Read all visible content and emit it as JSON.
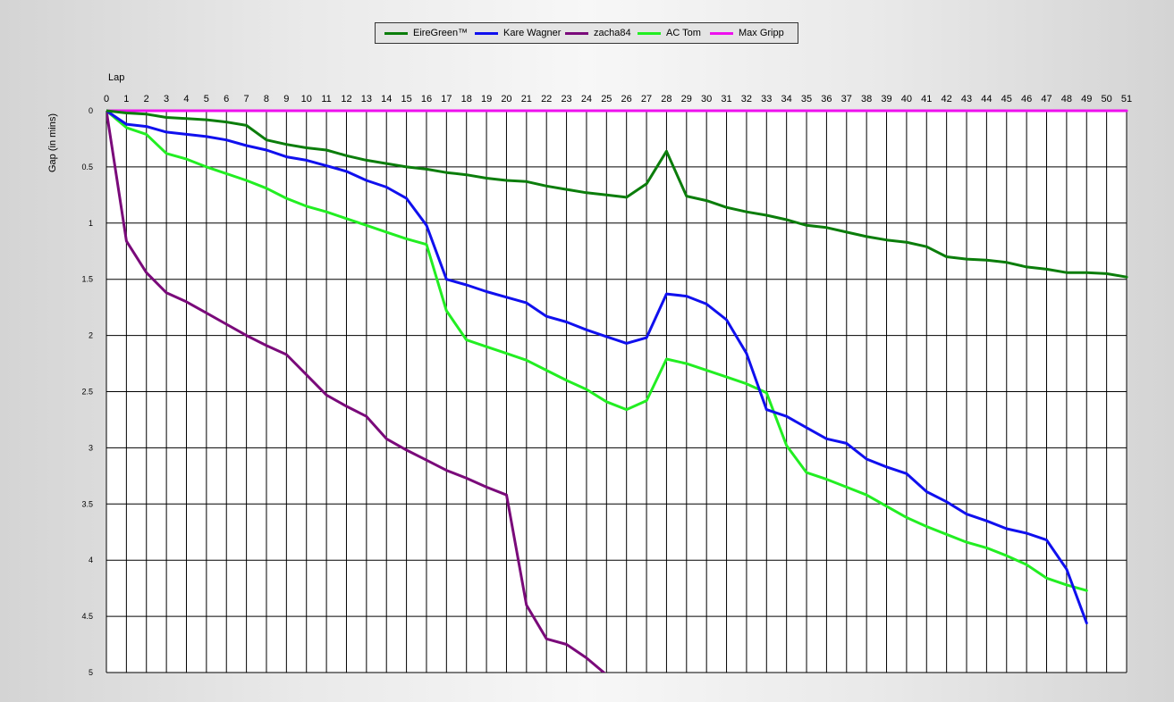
{
  "chart_data": {
    "type": "line",
    "title": "",
    "xlabel": "Lap",
    "ylabel": "Gap (in mins)",
    "x_ticks": [
      0,
      1,
      2,
      3,
      4,
      5,
      6,
      7,
      8,
      9,
      10,
      11,
      12,
      13,
      14,
      15,
      16,
      17,
      18,
      19,
      20,
      21,
      22,
      23,
      24,
      25,
      26,
      27,
      28,
      29,
      30,
      31,
      32,
      33,
      34,
      35,
      36,
      37,
      38,
      39,
      40,
      41,
      42,
      43,
      44,
      45,
      46,
      47,
      48,
      49,
      50,
      51
    ],
    "y_ticks": [
      "0",
      "0.5",
      "1",
      "1.5",
      "2",
      "2.5",
      "3",
      "3.5",
      "4",
      "4.5",
      "5"
    ],
    "xlim": [
      0,
      51
    ],
    "ylim": [
      0,
      5
    ],
    "y_inverted": true,
    "grid": true,
    "legend_position": "top-center",
    "series": [
      {
        "name": "EireGreen™",
        "color": "#0b7d0b",
        "x": [
          0,
          1,
          2,
          3,
          4,
          5,
          6,
          7,
          8,
          9,
          10,
          11,
          12,
          13,
          14,
          15,
          16,
          17,
          18,
          19,
          20,
          21,
          22,
          23,
          24,
          25,
          26,
          27,
          28,
          29,
          30,
          31,
          32,
          33,
          34,
          35,
          36,
          37,
          38,
          39,
          40,
          41,
          42,
          43,
          44,
          45,
          46,
          47,
          48,
          49,
          50,
          51
        ],
        "values": [
          0,
          0.02,
          0.03,
          0.06,
          0.07,
          0.08,
          0.1,
          0.13,
          0.26,
          0.3,
          0.33,
          0.35,
          0.4,
          0.44,
          0.47,
          0.5,
          0.52,
          0.55,
          0.57,
          0.6,
          0.62,
          0.63,
          0.67,
          0.7,
          0.73,
          0.75,
          0.77,
          0.65,
          0.36,
          0.76,
          0.8,
          0.86,
          0.9,
          0.93,
          0.97,
          1.02,
          1.04,
          1.08,
          1.12,
          1.15,
          1.17,
          1.21,
          1.3,
          1.32,
          1.33,
          1.35,
          1.39,
          1.41,
          1.44,
          1.44,
          1.45,
          1.48
        ]
      },
      {
        "name": "Kare Wagner",
        "color": "#1010ee",
        "x": [
          0,
          1,
          2,
          3,
          4,
          5,
          6,
          7,
          8,
          9,
          10,
          11,
          12,
          13,
          14,
          15,
          16,
          17,
          18,
          19,
          20,
          21,
          22,
          23,
          24,
          25,
          26,
          27,
          28,
          29,
          30,
          31,
          32,
          33,
          34,
          35,
          36,
          37,
          38,
          39,
          40,
          41,
          42,
          43,
          44,
          45,
          46,
          47,
          48,
          49
        ],
        "values": [
          0,
          0.12,
          0.14,
          0.19,
          0.21,
          0.23,
          0.26,
          0.31,
          0.35,
          0.41,
          0.44,
          0.49,
          0.54,
          0.62,
          0.68,
          0.78,
          1.02,
          1.5,
          1.55,
          1.61,
          1.66,
          1.71,
          1.83,
          1.88,
          1.95,
          2.01,
          2.07,
          2.02,
          1.63,
          1.65,
          1.72,
          1.86,
          2.16,
          2.66,
          2.72,
          2.82,
          2.92,
          2.96,
          3.1,
          3.17,
          3.23,
          3.39,
          3.48,
          3.59,
          3.65,
          3.72,
          3.76,
          3.82,
          4.08,
          4.56
        ]
      },
      {
        "name": "zacha84",
        "color": "#7a0a7a",
        "x": [
          0,
          1,
          2,
          3,
          4,
          5,
          6,
          7,
          8,
          9,
          10,
          11,
          12,
          13,
          14,
          15,
          16,
          17,
          18,
          19,
          20,
          21,
          22,
          23,
          24,
          25
        ],
        "values": [
          0,
          1.16,
          1.44,
          1.62,
          1.7,
          1.8,
          1.9,
          2.0,
          2.09,
          2.17,
          2.35,
          2.53,
          2.63,
          2.72,
          2.92,
          3.02,
          3.11,
          3.2,
          3.27,
          3.35,
          3.42,
          4.4,
          4.7,
          4.75,
          4.87,
          5.02
        ]
      },
      {
        "name": "AC Tom",
        "color": "#22ee22",
        "x": [
          0,
          1,
          2,
          3,
          4,
          5,
          6,
          7,
          8,
          9,
          10,
          11,
          12,
          13,
          14,
          15,
          16,
          17,
          18,
          19,
          20,
          21,
          22,
          23,
          24,
          25,
          26,
          27,
          28,
          29,
          30,
          31,
          32,
          33,
          34,
          35,
          36,
          37,
          38,
          39,
          40,
          41,
          42,
          43,
          44,
          45,
          46,
          47,
          48,
          49
        ],
        "values": [
          0,
          0.15,
          0.21,
          0.38,
          0.43,
          0.5,
          0.56,
          0.62,
          0.69,
          0.78,
          0.85,
          0.9,
          0.96,
          1.02,
          1.08,
          1.14,
          1.19,
          1.78,
          2.04,
          2.1,
          2.16,
          2.22,
          2.31,
          2.4,
          2.48,
          2.59,
          2.66,
          2.58,
          2.21,
          2.25,
          2.31,
          2.37,
          2.43,
          2.51,
          2.98,
          3.22,
          3.28,
          3.35,
          3.42,
          3.52,
          3.62,
          3.7,
          3.77,
          3.84,
          3.89,
          3.96,
          4.04,
          4.16,
          4.22,
          4.27
        ]
      },
      {
        "name": "Max Gripp",
        "color": "#ee10ee",
        "x": [
          0,
          1,
          2,
          3,
          4,
          5,
          6,
          7,
          8,
          9,
          10,
          11,
          12,
          13,
          14,
          15,
          16,
          17,
          18,
          19,
          20,
          21,
          22,
          23,
          24,
          25,
          26,
          27,
          28,
          29,
          30,
          31,
          32,
          33,
          34,
          35,
          36,
          37,
          38,
          39,
          40,
          41,
          42,
          43,
          44,
          45,
          46,
          47,
          48,
          49,
          50,
          51
        ],
        "values": [
          0,
          0,
          0,
          0,
          0,
          0,
          0,
          0,
          0,
          0,
          0,
          0,
          0,
          0,
          0,
          0,
          0,
          0,
          0,
          0,
          0,
          0,
          0,
          0,
          0,
          0,
          0,
          0,
          0,
          0,
          0,
          0,
          0,
          0,
          0,
          0,
          0,
          0,
          0,
          0,
          0,
          0,
          0,
          0,
          0,
          0,
          0,
          0,
          0,
          0,
          0,
          0
        ]
      }
    ]
  }
}
